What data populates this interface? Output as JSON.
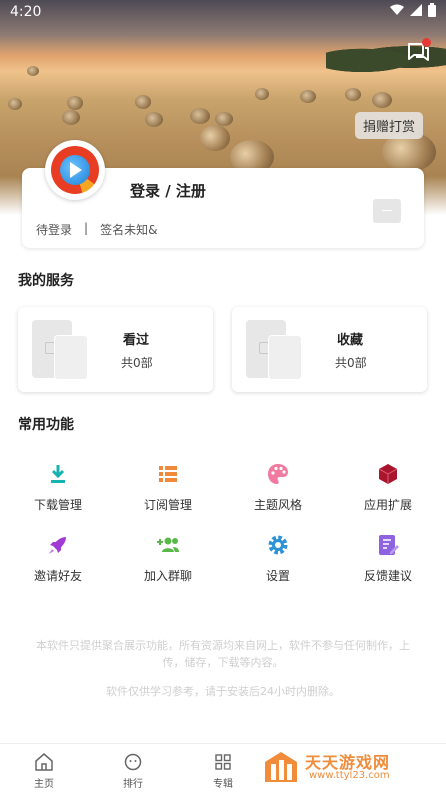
{
  "status_bar": {
    "time": "4:20"
  },
  "header": {
    "donate_label": "捐赠打赏"
  },
  "profile": {
    "login_label": "登录 / 注册",
    "status": "待登录",
    "separator": "|",
    "signature": "签名未知&"
  },
  "services": {
    "title": "我的服务",
    "items": [
      {
        "label": "看过",
        "count": "共0部"
      },
      {
        "label": "收藏",
        "count": "共0部"
      }
    ]
  },
  "functions": {
    "title": "常用功能",
    "items": [
      {
        "label": "下载管理",
        "icon": "download-icon",
        "color": "#17b3b0"
      },
      {
        "label": "订阅管理",
        "icon": "list-icon",
        "color": "#f0893a"
      },
      {
        "label": "主题风格",
        "icon": "palette-icon",
        "color": "#f07aa0"
      },
      {
        "label": "应用扩展",
        "icon": "cube-icon",
        "color": "#a8152c"
      },
      {
        "label": "邀请好友",
        "icon": "rocket-icon",
        "color": "#a23ad6"
      },
      {
        "label": "加入群聊",
        "icon": "add-group-icon",
        "color": "#5ab84a"
      },
      {
        "label": "设置",
        "icon": "gear-icon",
        "color": "#2d93d6"
      },
      {
        "label": "反馈建议",
        "icon": "feedback-icon",
        "color": "#8e63e0"
      }
    ]
  },
  "disclaimer": {
    "line1": "本软件只提供聚合展示功能，所有资源均来自网上，软件不参与任何制作，上传，储存，下载等内容。",
    "line2": "软件仅供学习参考，请于安装后24小时内删除。"
  },
  "nav": {
    "items": [
      {
        "label": "主页"
      },
      {
        "label": "排行"
      },
      {
        "label": "专辑"
      }
    ]
  },
  "watermark": {
    "text": "天天游戏网",
    "url": "www.ttyl23.com"
  }
}
